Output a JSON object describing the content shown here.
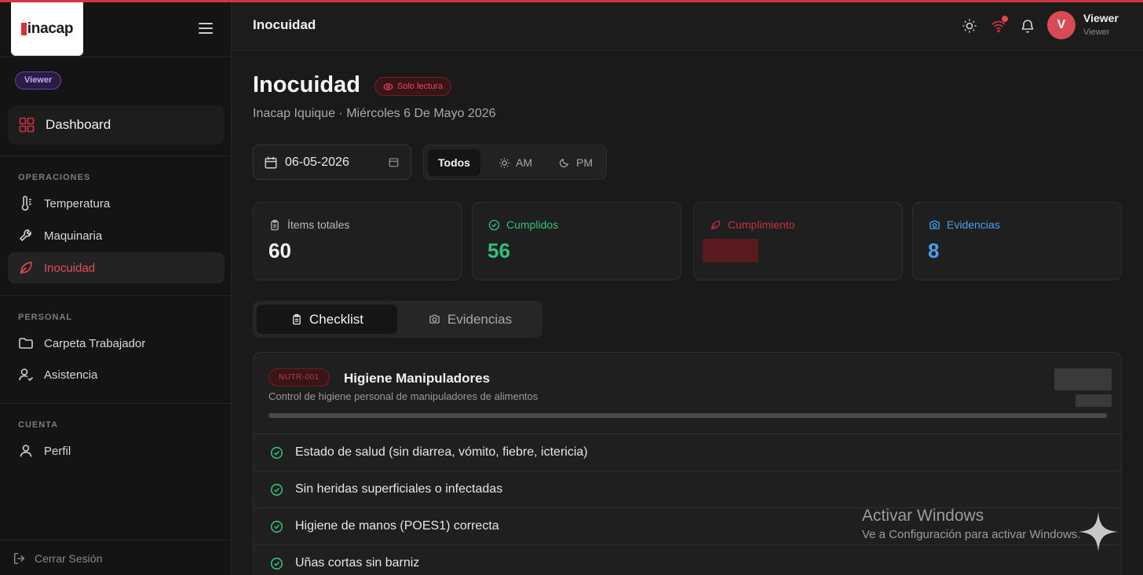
{
  "colors": {
    "accent": "#d1323f",
    "success": "#33c07a",
    "info": "#4a9ff0",
    "role_purple": "#c4a4ff"
  },
  "sidebar": {
    "logo": "inacap",
    "role_badge": "Viewer",
    "dashboard": {
      "label": "Dashboard",
      "icon": "grid-icon"
    },
    "sections": [
      {
        "title": "OPERACIONES",
        "items": [
          {
            "label": "Temperatura",
            "icon": "thermometer-icon",
            "active": false
          },
          {
            "label": "Maquinaria",
            "icon": "wrench-icon",
            "active": false
          },
          {
            "label": "Inocuidad",
            "icon": "leaf-icon",
            "active": true
          }
        ]
      },
      {
        "title": "PERSONAL",
        "items": [
          {
            "label": "Carpeta Trabajador",
            "icon": "folder-icon",
            "active": false
          },
          {
            "label": "Asistencia",
            "icon": "user-check-icon",
            "active": false
          }
        ]
      },
      {
        "title": "CUENTA",
        "items": [
          {
            "label": "Perfil",
            "icon": "user-icon",
            "active": false
          }
        ]
      }
    ],
    "logout": "Cerrar Sesión"
  },
  "header": {
    "title": "Inocuidad",
    "user": {
      "initial": "V",
      "name": "Viewer",
      "role": "Viewer"
    }
  },
  "main": {
    "title": "Inocuidad",
    "readonly_badge": "Solo lectura",
    "subtitle": "Inacap Iquique · Miércoles 6 De Mayo 2026",
    "date_value": "06-05-2026",
    "shift_filter": {
      "options": [
        "Todos",
        "AM",
        "PM"
      ],
      "selected": "Todos"
    },
    "stats": [
      {
        "label": "Ítems totales",
        "value": "60",
        "icon": "clipboard-icon"
      },
      {
        "label": "Cumplidos",
        "value": "56",
        "icon": "check-circle-icon"
      },
      {
        "label": "Cumplimiento",
        "value": "",
        "icon": "leaf-icon"
      },
      {
        "label": "Evidencias",
        "value": "8",
        "icon": "camera-icon"
      }
    ],
    "tabs": [
      {
        "label": "Checklist",
        "icon": "clipboard-icon",
        "active": true
      },
      {
        "label": "Evidencias",
        "icon": "camera-icon",
        "active": false
      }
    ],
    "checklist": {
      "code": "NUTR-001",
      "title": "Higiene Manipuladores",
      "description": "Control de higiene personal de manipuladores de alimentos",
      "progress": 1.0,
      "items": [
        "Estado de salud (sin diarrea, vómito, fiebre, ictericia)",
        "Sin heridas superficiales o infectadas",
        "Higiene de manos (POES1) correcta",
        "Uñas cortas sin barniz"
      ]
    }
  },
  "watermark": {
    "line1": "Activar Windows",
    "line2": "Ve a Configuración para activar Windows."
  }
}
